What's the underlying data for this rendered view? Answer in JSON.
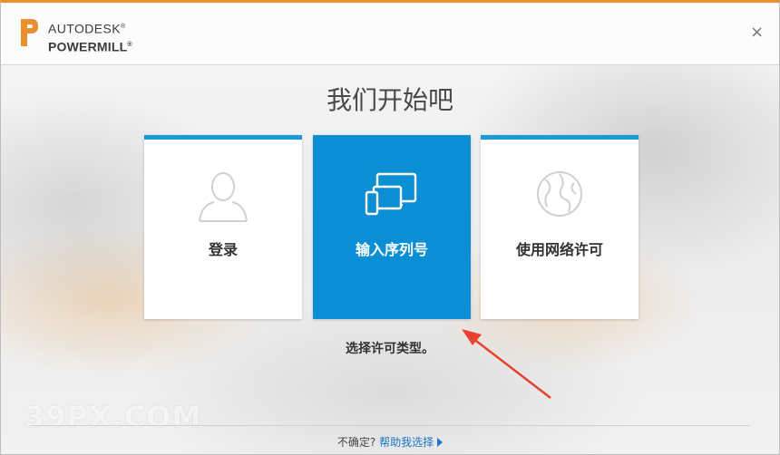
{
  "header": {
    "brand_line1": "AUTODESK",
    "brand_line1_mark": "®",
    "brand_line2": "POWERMILL",
    "brand_line2_mark": "®",
    "close_glyph": "×"
  },
  "main": {
    "title": "我们开始吧",
    "cards": [
      {
        "label": "登录",
        "icon": "user-icon",
        "selected": false
      },
      {
        "label": "输入序列号",
        "icon": "devices-icon",
        "selected": true
      },
      {
        "label": "使用网络许可",
        "icon": "globe-icon",
        "selected": false
      }
    ],
    "subtitle": "选择许可类型。"
  },
  "footer": {
    "question": "不确定?",
    "help_link": "帮助我选择"
  },
  "watermark": "39PX.COM",
  "colors": {
    "accent": "#0b8fd4",
    "header_border": "#e8902f",
    "annotation_arrow": "#e8412e"
  }
}
